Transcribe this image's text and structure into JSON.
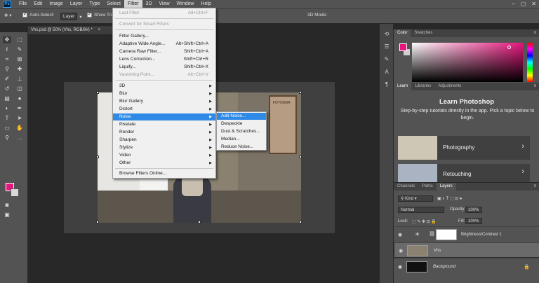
{
  "menubar": {
    "logo": "Ps",
    "items": [
      "File",
      "Edit",
      "Image",
      "Layer",
      "Type",
      "Select",
      "Filter",
      "3D",
      "View",
      "Window",
      "Help"
    ],
    "active": "Filter"
  },
  "options": {
    "auto_select_label": "Auto-Select:",
    "auto_select_value": "Layer",
    "show_transform": "Show Tra",
    "mode_3d": "3D Mode:"
  },
  "document": {
    "tab_title": "Vhs.psd @ 50% (Vhs, RGB/8#) *"
  },
  "photo": {
    "sign_text": "FOTOGRA"
  },
  "filter_menu": {
    "items": [
      {
        "label": "Last Filter",
        "shortcut": "Alt+Ctrl+F",
        "disabled": true
      },
      {
        "label": "Convert for Smart Filters",
        "disabled": true
      },
      {
        "label": "Filter Gallery..."
      },
      {
        "label": "Adaptive Wide Angle...",
        "shortcut": "Alt+Shift+Ctrl+A"
      },
      {
        "label": "Camera Raw Filter...",
        "shortcut": "Shift+Ctrl+A"
      },
      {
        "label": "Lens Correction...",
        "shortcut": "Shift+Ctrl+R"
      },
      {
        "label": "Liquify...",
        "shortcut": "Shift+Ctrl+X"
      },
      {
        "label": "Vanishing Point...",
        "shortcut": "Alt+Ctrl+V",
        "disabled": true
      },
      {
        "label": "3D"
      },
      {
        "label": "Blur"
      },
      {
        "label": "Blur Gallery"
      },
      {
        "label": "Distort"
      },
      {
        "label": "Noise"
      },
      {
        "label": "Pixelate"
      },
      {
        "label": "Render"
      },
      {
        "label": "Sharpen"
      },
      {
        "label": "Stylize"
      },
      {
        "label": "Video"
      },
      {
        "label": "Other"
      },
      {
        "label": "Browse Filters Online..."
      }
    ]
  },
  "noise_submenu": {
    "items": [
      "Add Noise...",
      "Despeckle",
      "Dust & Scratches...",
      "Median...",
      "Reduce Noise..."
    ]
  },
  "color_panel": {
    "tabs": [
      "Color",
      "Swatches"
    ],
    "foreground": "#e5167c",
    "background": "#cfcfcf"
  },
  "learn_panel": {
    "tabs": [
      "Learn",
      "Libraries",
      "Adjustments"
    ],
    "title": "Learn Photoshop",
    "description": "Step-by-step tutorials directly in the app. Pick a topic below to begin.",
    "cards": [
      "Photography",
      "Retouching"
    ]
  },
  "layers_panel": {
    "tabs": [
      "Channels",
      "Paths",
      "Layers"
    ],
    "kind_label": "Kind",
    "blend_mode": "Normal",
    "opacity_label": "Opacity:",
    "opacity_value": "100%",
    "lock_label": "Lock:",
    "fill_label": "Fill:",
    "fill_value": "100%",
    "layers": [
      {
        "name": "Brightness/Contrast 1"
      },
      {
        "name": "Vhs"
      },
      {
        "name": "Background"
      }
    ]
  }
}
